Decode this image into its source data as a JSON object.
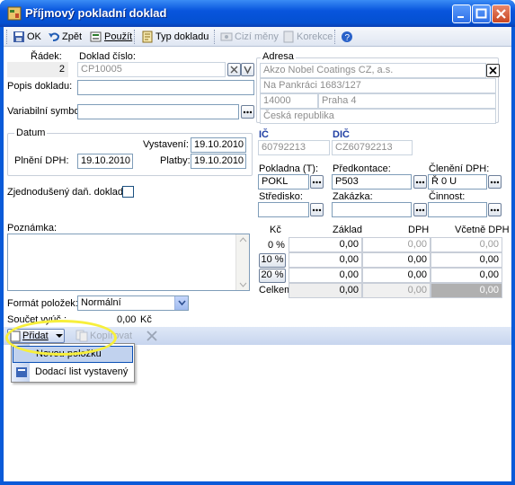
{
  "window": {
    "title": "Příjmový pokladní doklad"
  },
  "toolbar": {
    "ok": "OK",
    "back": "Zpět",
    "use": "Použít",
    "doc_type": "Typ dokladu",
    "target_prices": "Cizí měny",
    "correction": "Korekce"
  },
  "form": {
    "radek_label": "Řádek:",
    "radek_value": "2",
    "doklad_cislo_label": "Doklad číslo:",
    "doklad_cislo_value": "CP10005",
    "popis_label": "Popis dokladu:",
    "popis_value": "",
    "var_symbol_label": "Variabilní symbol:",
    "var_symbol_value": "",
    "datum_label": "Datum",
    "vystaveni_label": "Vystavení:",
    "vystaveni_value": "19.10.2010",
    "plneni_label": "Plnění DPH:",
    "plneni_value": "19.10.2010",
    "platby_label": "Platby:",
    "platby_value": "19.10.2010",
    "zjednoduseny_label": "Zjednodušený daň. doklad:",
    "poznamka_label": "Poznámka:",
    "format_label": "Formát položek:",
    "format_value": "Normální",
    "soucet_label": "Součet vyúč.:",
    "soucet_value": "0,00",
    "soucet_currency": "Kč"
  },
  "address": {
    "label": "Adresa",
    "line1": "Akzo Nobel Coatings CZ, a.s.",
    "line2": "Na Pankráci 1683/127",
    "zip": "14000",
    "city": "Praha 4",
    "country": "Česká republika"
  },
  "ids": {
    "ic_label": "IČ",
    "ic_value": "60792213",
    "dic_label": "DIČ",
    "dic_value": "CZ60792213"
  },
  "codes": {
    "pokladna_label": "Pokladna (T):",
    "pokladna_value": "POKL",
    "predkontace_label": "Předkontace:",
    "predkontace_value": "P503",
    "cleneni_label": "Členění DPH:",
    "cleneni_value": "Ř 0 U",
    "stredisko_label": "Středisko:",
    "zakazka_label": "Zakázka:",
    "cinnost_label": "Činnost:"
  },
  "vat": {
    "headers": [
      "Kč",
      "Základ",
      "DPH",
      "Včetně DPH"
    ],
    "rows": [
      {
        "label": "0 %",
        "zaklad": "0,00",
        "dph": "0,00",
        "vcetne": "0,00"
      },
      {
        "label": "10 %",
        "zaklad": "0,00",
        "dph": "0,00",
        "vcetne": "0,00"
      },
      {
        "label": "20 %",
        "zaklad": "0,00",
        "dph": "0,00",
        "vcetne": "0,00"
      },
      {
        "label": "Celkem",
        "zaklad": "0,00",
        "dph": "0,00",
        "vcetne": "0,00"
      }
    ]
  },
  "items_bar": {
    "add": "Přidat",
    "copy": "Kopírovat"
  },
  "add_menu": {
    "items": [
      "Novou položku",
      "Dodací list vystavený"
    ]
  },
  "colors": {
    "title_bar": "#0855dd",
    "highlight": "#f7ef3b"
  }
}
